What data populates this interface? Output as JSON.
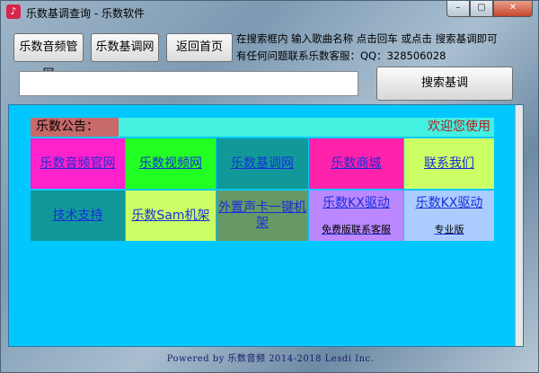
{
  "window": {
    "title": "乐数基调查询 - 乐数软件",
    "minimize": "–",
    "maximize": "▢",
    "close": "✕"
  },
  "toolbar": {
    "music_site": "乐数音频管网",
    "key_site": "乐数基调网",
    "home": "返回首页"
  },
  "hint": {
    "line1": "在搜索框内 输入歌曲名称 点击回车 或点击 搜索基调即可",
    "line2": "有任何问题联系乐数客服：QQ：328506028"
  },
  "search": {
    "value": "",
    "button": "搜索基调"
  },
  "notice": {
    "label": "乐数公告：",
    "text": "欢迎您使用"
  },
  "tiles": [
    {
      "label": "乐数音频官网",
      "bg": "#ff22cc",
      "color": "#2a2ad0"
    },
    {
      "label": "乐数视频网",
      "bg": "#22ff22",
      "color": "#1a2fd8"
    },
    {
      "label": "乐数基调网",
      "bg": "#119999",
      "color": "#1a2fd8"
    },
    {
      "label": "乐数商城",
      "bg": "#ff22aa",
      "color": "#1a2fd8"
    },
    {
      "label": "联系我们",
      "bg": "#ccff66",
      "color": "#1a2fd8"
    },
    {
      "label": "技术支持",
      "bg": "#119999",
      "color": "#1a2fd8"
    },
    {
      "label": "乐数Sam机架",
      "bg": "#ccff66",
      "color": "#1a2fd8"
    },
    {
      "label": "外置声卡一键机架",
      "bg": "#669966",
      "color": "#1a2fd8"
    },
    {
      "label": "乐数KX驱动",
      "sub": "免费版联系客服",
      "bg": "#bb88ff",
      "color": "#1a2fd8"
    },
    {
      "label": "乐数KX驱动",
      "sub": "专业版",
      "bg": "#aaccff",
      "color": "#1a2fd8"
    }
  ],
  "footer": "Powered by 乐数音频  2014-2018 Lesdi Inc."
}
